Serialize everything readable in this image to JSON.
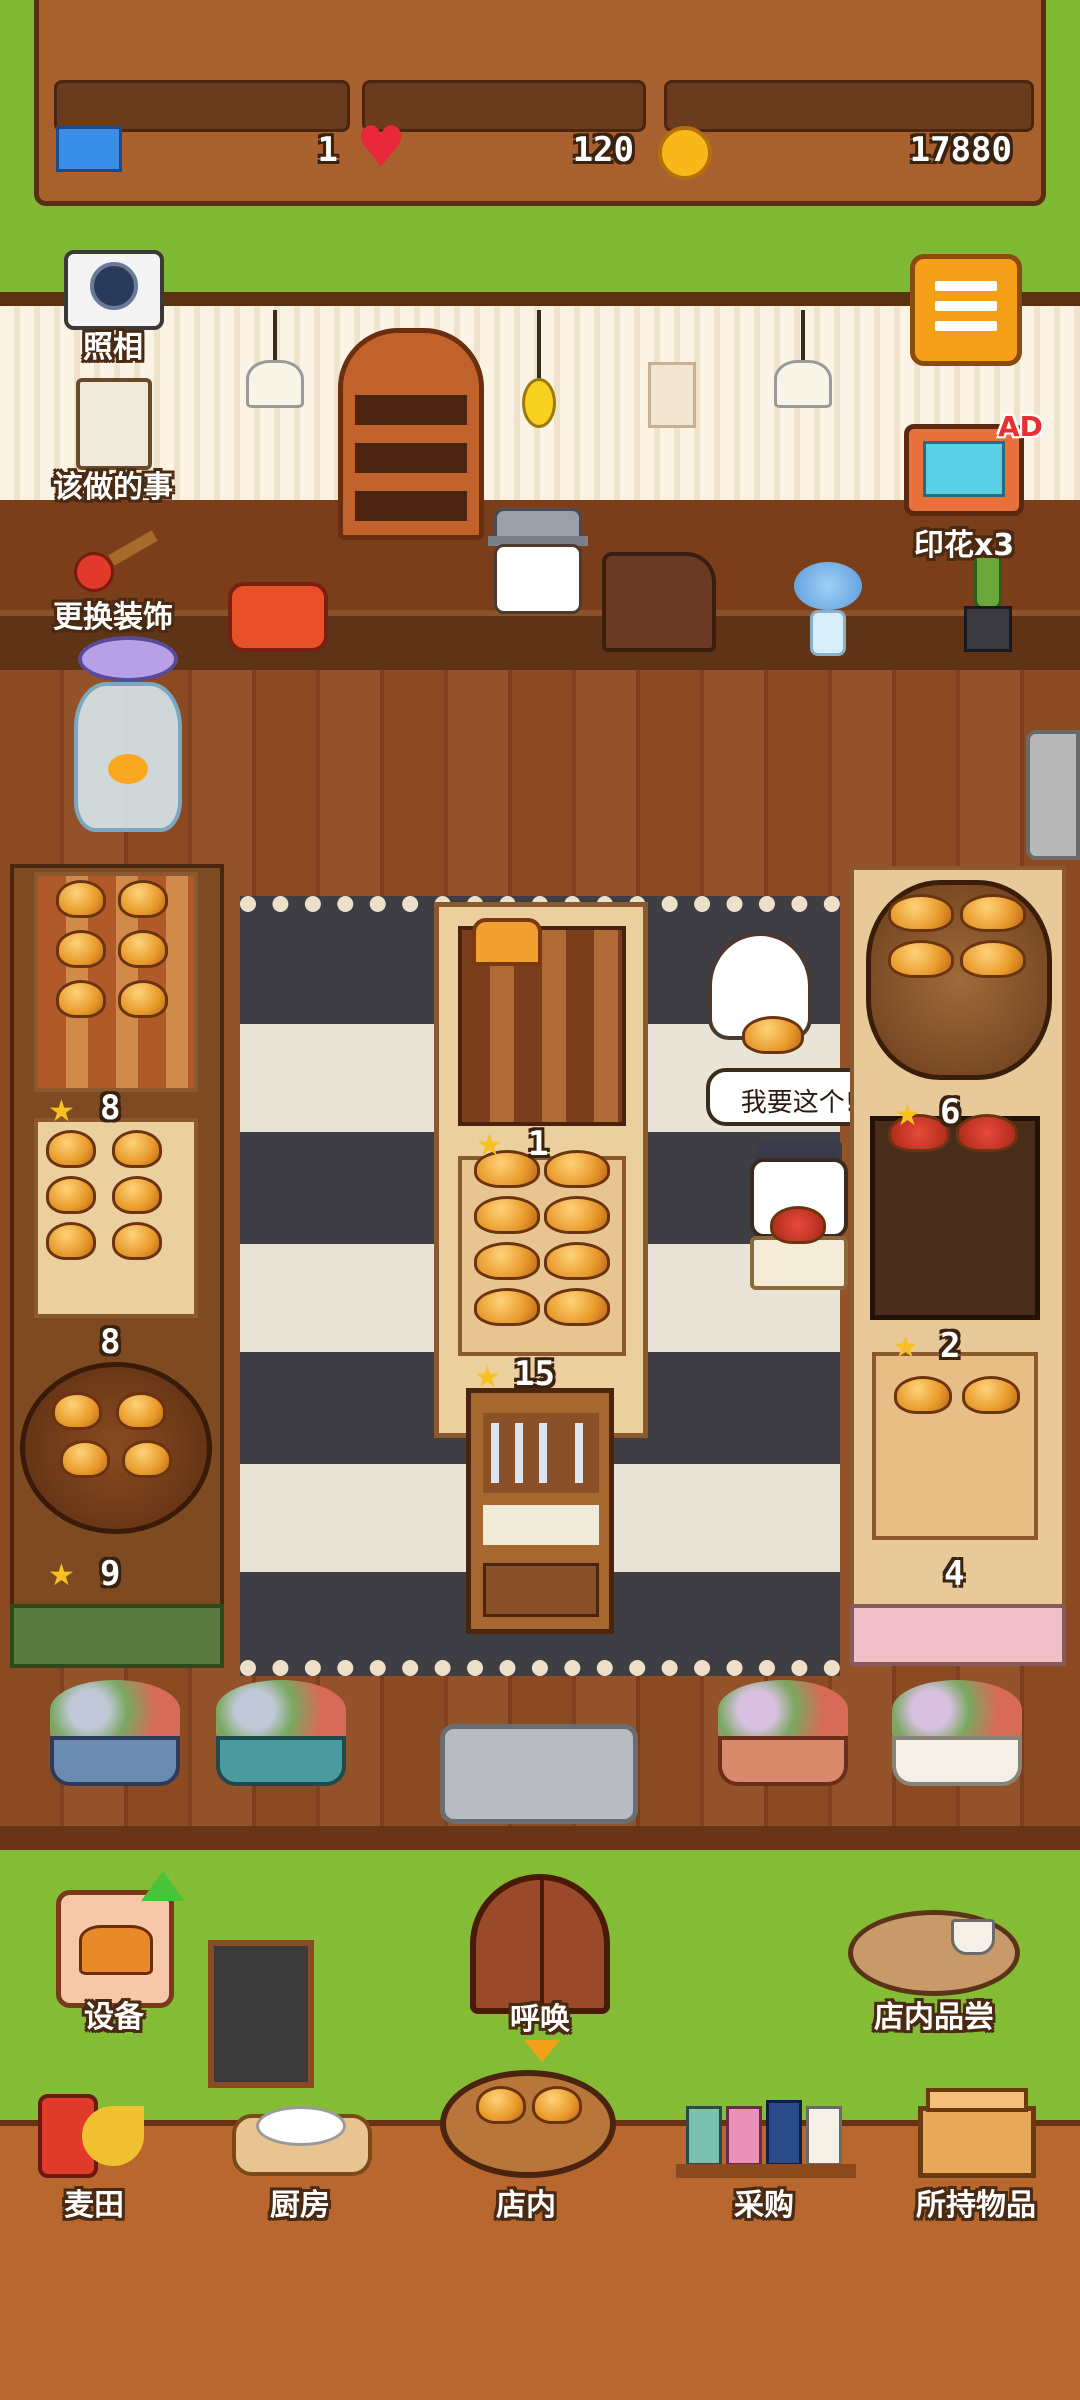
{
  "status_bar": {
    "tickets": "1",
    "hearts": "120",
    "coins": "17880"
  },
  "side_menu": {
    "photo_label": "照相",
    "todo_label": "该做的事",
    "decor_label": "更换装饰",
    "stamp_label": "印花x3",
    "ad_badge": "AD"
  },
  "speech_bubble": "我要这个!",
  "shop_items": {
    "left_top_rating": "8",
    "left_mid_rating": "8",
    "left_bottom_rating": "9",
    "center_top_rating": "1",
    "center_bottom_rating": "15",
    "right_top_rating": "6",
    "right_mid_rating": "2",
    "right_bottom_count": "4"
  },
  "floor_buttons": {
    "equipment_label": "设备",
    "call_label": "呼唤",
    "tasting_label": "店内品尝"
  },
  "bottom_nav": [
    {
      "label": "麦田"
    },
    {
      "label": "厨房"
    },
    {
      "label": "店内"
    },
    {
      "label": "采购"
    },
    {
      "label": "所持物品"
    }
  ],
  "colors": {
    "grass": "#7fb832",
    "wood_dark": "#6a3c1d",
    "wood_floor": "#8b4a22",
    "accent_orange": "#f6a01a"
  }
}
